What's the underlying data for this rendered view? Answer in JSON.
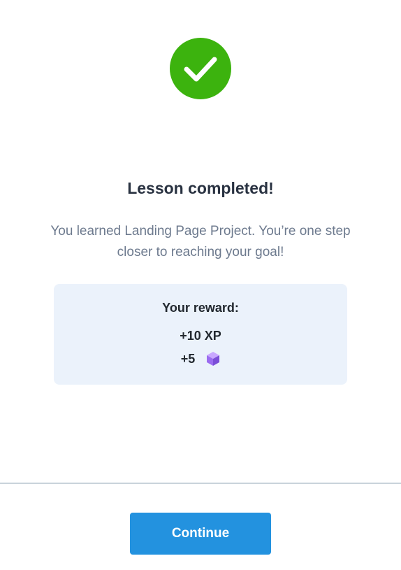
{
  "status_icon": "check-icon",
  "title": "Lesson completed!",
  "message": "You learned Landing Page Project. You’re one step closer to reaching your goal!",
  "reward": {
    "heading": "Your reward:",
    "xp": "+10 XP",
    "gems": "+5",
    "gem_icon": "purple-cube-icon"
  },
  "continue_label": "Continue",
  "colors": {
    "success": "#3cb30e",
    "accent": "#2392df",
    "reward_bg": "#ebf2fb",
    "gem": "#9b6cf0"
  }
}
